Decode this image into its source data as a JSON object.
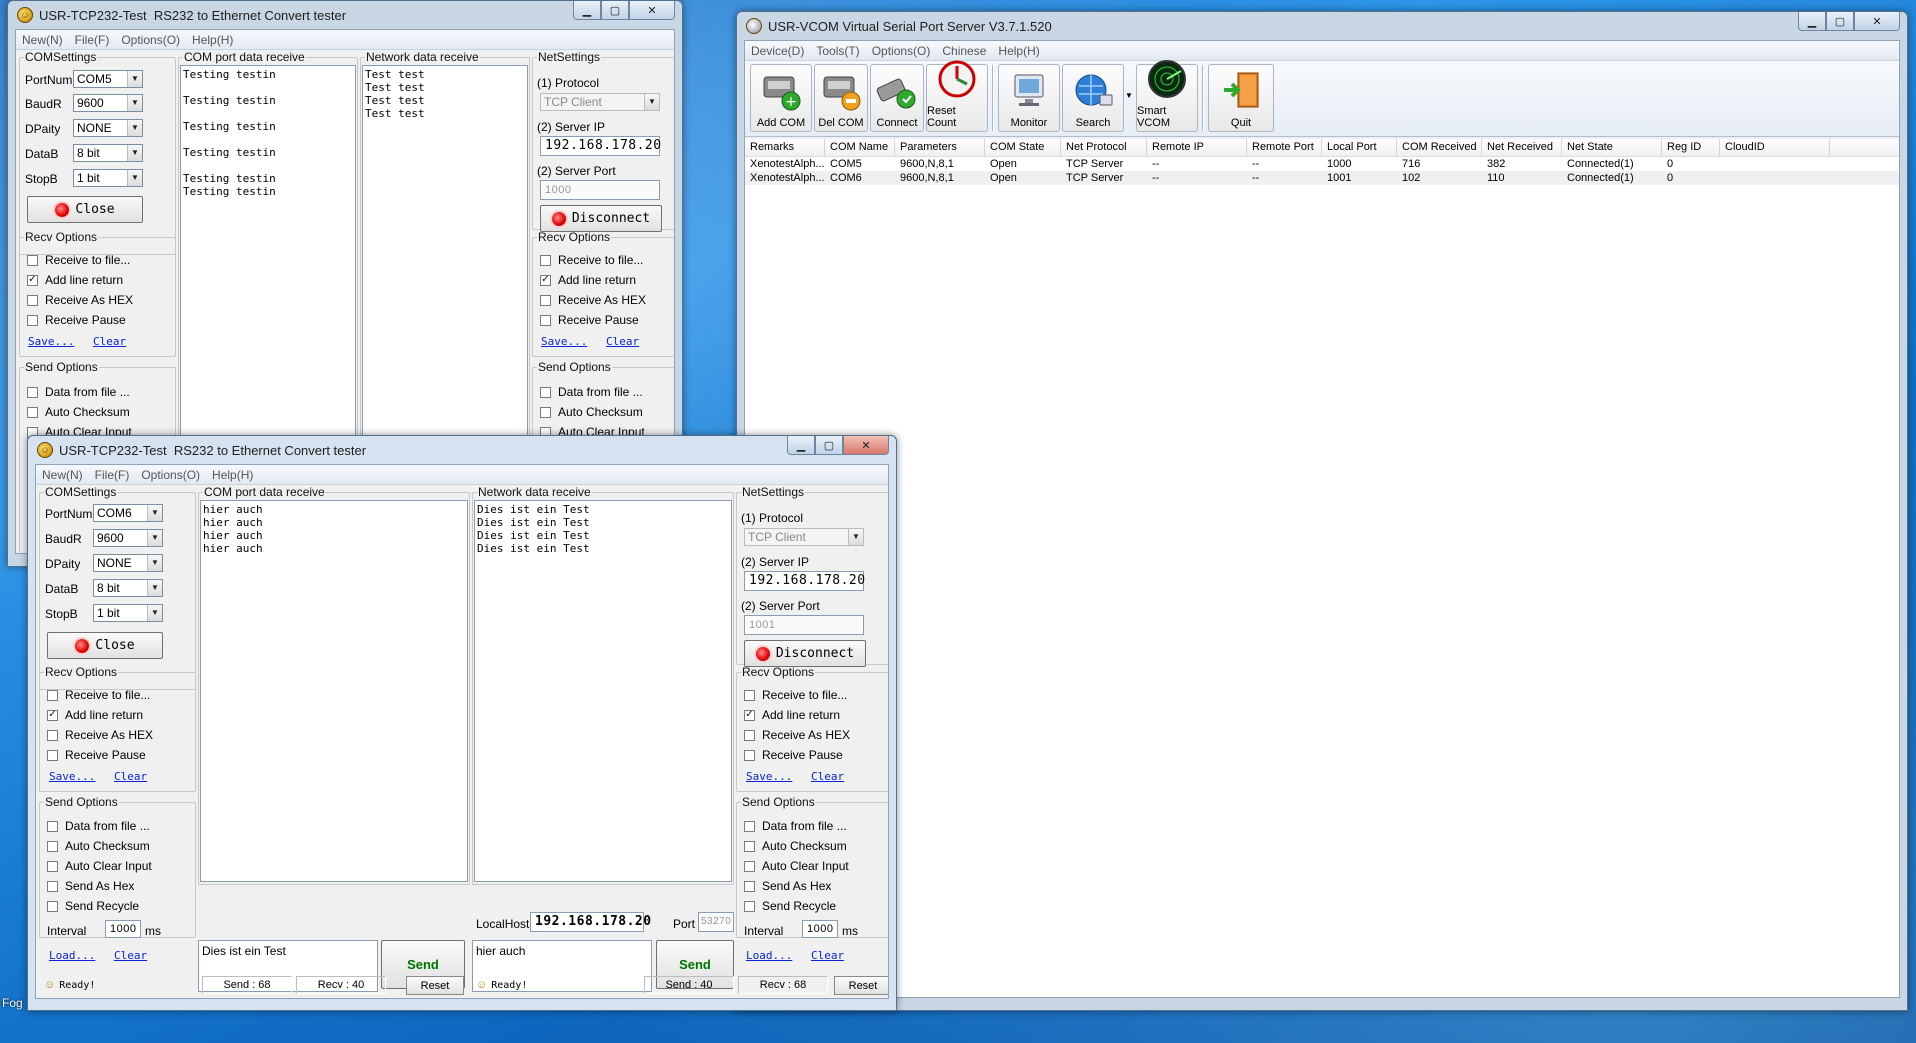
{
  "desktop": {
    "bottom_left_label": "Fog"
  },
  "tcp_common": {
    "menu": [
      "New(N)",
      "File(F)",
      "Options(O)",
      "Help(H)"
    ],
    "com_settings": {
      "legend": "COMSettings",
      "portnum_label": "PortNum",
      "baud_label": "BaudR",
      "parity_label": "DPaity",
      "databits_label": "DataB",
      "stopbits_label": "StopB",
      "baud": "9600",
      "parity": "NONE",
      "databits": "8 bit",
      "stopbits": "1 bit",
      "close_label": "Close"
    },
    "com_receive_legend": "COM port data receive",
    "net_receive_legend": "Network data receive",
    "net_settings": {
      "legend": "NetSettings",
      "protocol_label": "(1) Protocol",
      "protocol": "TCP Client",
      "server_ip_label": "(2) Server IP",
      "server_ip": "192.168.178.20",
      "server_port_label": "(2) Server Port",
      "disconnect_label": "Disconnect"
    },
    "recv_options": {
      "legend": "Recv Options",
      "receive_to_file": "Receive to file...",
      "add_line_return": "Add line return",
      "receive_as_hex": "Receive As HEX",
      "receive_pause": "Receive Pause",
      "save": "Save...",
      "clear": "Clear"
    },
    "send_options": {
      "legend": "Send Options",
      "data_from_file": "Data from file ...",
      "auto_checksum": "Auto Checksum",
      "auto_clear_input": "Auto Clear Input",
      "send_as_hex": "Send As Hex",
      "send_recycle": "Send Recycle",
      "interval_label": "Interval",
      "interval": "1000",
      "interval_unit": "ms",
      "load": "Load...",
      "clear": "Clear"
    },
    "send_label": "Send",
    "ready": "Ready!",
    "reset": "Reset",
    "localhost_label": "LocalHost",
    "localhost": "192.168.178.20",
    "port_label": "Port"
  },
  "tcp1": {
    "title": "USR-TCP232-Test  RS232 to Ethernet Convert tester",
    "portnum": "COM5",
    "server_port": "1000",
    "com_lines": "Testing testin\n\nTesting testin\n\nTesting testin\n\nTesting testin\n\nTesting testin\nTesting testin",
    "net_lines": "Test test\nTest test\nTest test\nTest test"
  },
  "tcp2": {
    "title": "USR-TCP232-Test  RS232 to Ethernet Convert tester",
    "portnum": "COM6",
    "server_port": "1001",
    "com_lines": "hier auch\nhier auch\nhier auch\nhier auch",
    "net_lines": "Dies ist ein Test\nDies ist ein Test\nDies ist ein Test\nDies ist ein Test",
    "com_send_text": "Dies ist ein Test",
    "net_send_text": "hier auch",
    "local_port": "53270",
    "com_send_count": "Send : 68",
    "com_recv_count": "Recv : 40",
    "net_send_count": "Send : 40",
    "net_recv_count": "Recv : 68"
  },
  "vcom": {
    "title": "USR-VCOM Virtual Serial Port Server V3.7.1.520",
    "menu": [
      "Device(D)",
      "Tools(T)",
      "Options(O)",
      "Chinese",
      "Help(H)"
    ],
    "toolbar": {
      "add_com": "Add COM",
      "del_com": "Del COM",
      "connect": "Connect",
      "reset_count": "Reset Count",
      "monitor": "Monitor",
      "search": "Search",
      "smart_vcom": "Smart VCOM",
      "quit": "Quit"
    },
    "columns": [
      "Remarks",
      "COM Name",
      "Parameters",
      "COM State",
      "Net Protocol",
      "Remote IP",
      "Remote Port",
      "Local Port",
      "COM Received",
      "Net Received",
      "Net State",
      "Reg ID",
      "CloudID"
    ],
    "rows": [
      [
        "XenotestAlph...",
        "COM5",
        "9600,N,8,1",
        "Open",
        "TCP Server",
        "--",
        "--",
        "1000",
        "716",
        "382",
        "Connected(1)",
        "0",
        ""
      ],
      [
        "XenotestAlph...",
        "COM6",
        "9600,N,8,1",
        "Open",
        "TCP Server",
        "--",
        "--",
        "1001",
        "102",
        "110",
        "Connected(1)",
        "0",
        ""
      ]
    ]
  },
  "colors": {
    "send_green": "#007400",
    "link_blue": "#0b24d8",
    "led_red": "#e00000"
  }
}
